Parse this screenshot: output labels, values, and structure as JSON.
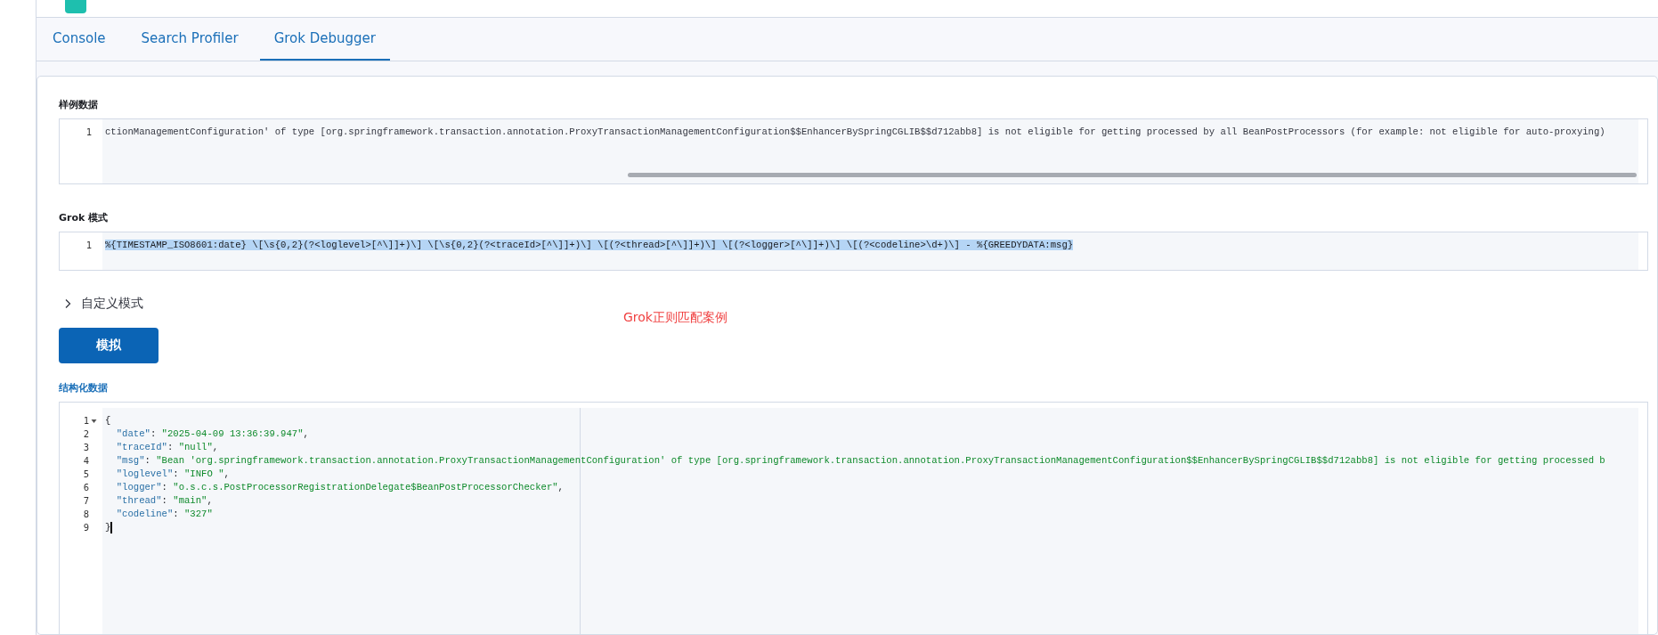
{
  "tabs": [
    {
      "label": "Console",
      "selected": false
    },
    {
      "label": "Search Profiler",
      "selected": false
    },
    {
      "label": "Grok Debugger",
      "selected": true
    }
  ],
  "sample_data": {
    "label": "样例数据",
    "lines": [
      {
        "number": "1",
        "text": "ctionManagementConfiguration' of type [org.springframework.transaction.annotation.ProxyTransactionManagementConfiguration$$EnhancerBySpringCGLIB$$d712abb8] is not eligible for getting processed by all BeanPostProcessors (for example: not eligible for auto-proxying)"
      }
    ]
  },
  "grok_pattern": {
    "label": "Grok 模式",
    "lines": [
      {
        "number": "1",
        "text": "%{TIMESTAMP_ISO8601:date} \\[\\s{0,2}(?<loglevel>[^\\]]+)\\] \\[\\s{0,2}(?<traceId>[^\\]]+)\\] \\[(?<thread>[^\\]]+)\\] \\[(?<logger>[^\\]]+)\\] \\[(?<codeline>\\d+)\\] - %{GREEDYDATA:msg}",
        "selected": true
      }
    ]
  },
  "custom_patterns": {
    "label": "自定义模式",
    "expanded": false
  },
  "annotation": "Grok正则匹配案例",
  "simulate_button": "模拟",
  "structured_data": {
    "label": "结构化数据",
    "lines": [
      {
        "number": "1",
        "tail": "{",
        "foldable": true
      },
      {
        "number": "2",
        "key": "\"date\"",
        "sep": ": ",
        "value": "\"2025-04-09 13:36:39.947\"",
        "tail": ","
      },
      {
        "number": "3",
        "key": "\"traceId\"",
        "sep": ": ",
        "value": "\"null\"",
        "tail": ","
      },
      {
        "number": "4",
        "key": "\"msg\"",
        "sep": ": ",
        "value": "\"Bean 'org.springframework.transaction.annotation.ProxyTransactionManagementConfiguration' of type [org.springframework.transaction.annotation.ProxyTransactionManagementConfiguration$$EnhancerBySpringCGLIB$$d712abb8] is not eligible for getting processed b"
      },
      {
        "number": "5",
        "key": "\"loglevel\"",
        "sep": ": ",
        "value": "\"INFO \"",
        "tail": ","
      },
      {
        "number": "6",
        "key": "\"logger\"",
        "sep": ": ",
        "value": "\"o.s.c.s.PostProcessorRegistrationDelegate$BeanPostProcessorChecker\"",
        "tail": ","
      },
      {
        "number": "7",
        "key": "\"thread\"",
        "sep": ": ",
        "value": "\"main\"",
        "tail": ","
      },
      {
        "number": "8",
        "key": "\"codeline\"",
        "sep": ": ",
        "value": "\"327\""
      },
      {
        "number": "9",
        "tail": "}",
        "cursor": true
      }
    ]
  }
}
